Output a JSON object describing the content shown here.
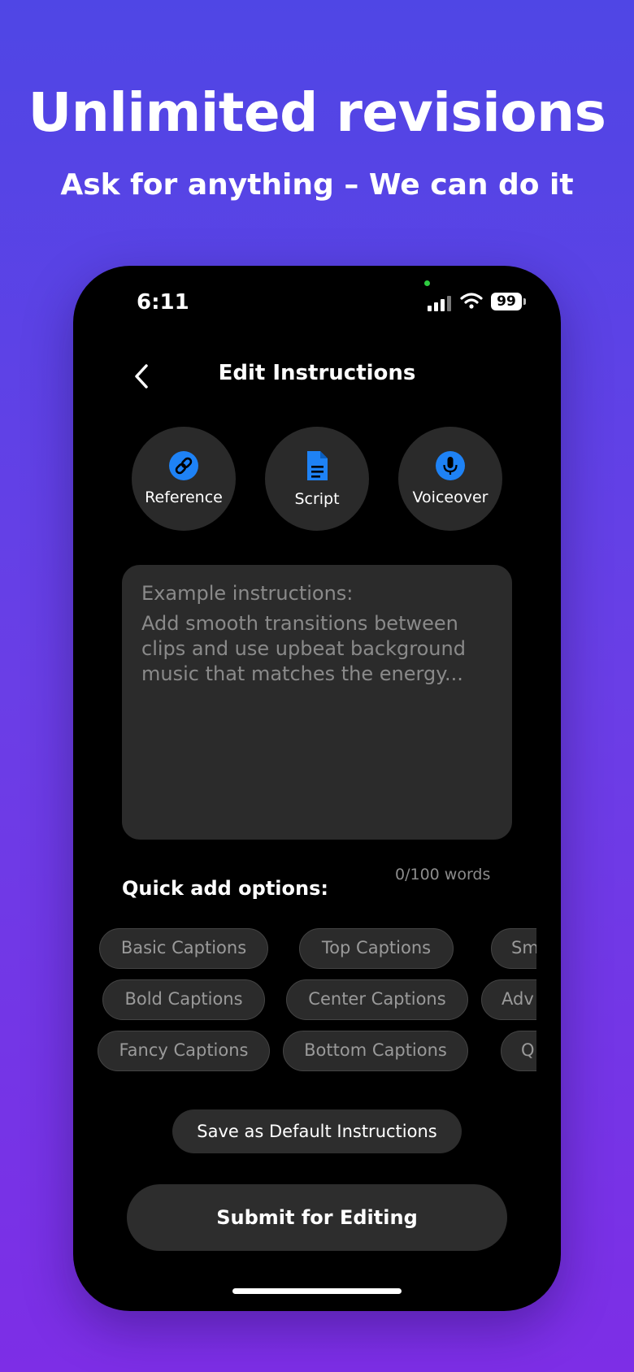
{
  "hero": {
    "title": "Unlimited revisions",
    "subtitle": "Ask for anything – We can do it"
  },
  "status_bar": {
    "time": "6:11",
    "battery": "99"
  },
  "nav": {
    "title": "Edit Instructions",
    "back_icon": "chevron-left-icon"
  },
  "actions": [
    {
      "label": "Reference",
      "icon": "link-icon"
    },
    {
      "label": "Script",
      "icon": "document-icon"
    },
    {
      "label": "Voiceover",
      "icon": "microphone-icon"
    }
  ],
  "instructions": {
    "placeholder_head": "Example instructions:",
    "placeholder_body": "Add smooth transitions between clips and use upbeat background music that matches the energy...",
    "word_count": "0/100 words"
  },
  "quick_add": {
    "label": "Quick add options:",
    "rows": [
      [
        "Basic Captions",
        "Top Captions",
        "Sm"
      ],
      [
        "Bold Captions",
        "Center Captions",
        "Adv"
      ],
      [
        "Fancy Captions",
        "Bottom Captions",
        "Q"
      ]
    ]
  },
  "buttons": {
    "save_default": "Save as Default Instructions",
    "submit": "Submit for Editing"
  },
  "colors": {
    "accent": "#1e82f5",
    "background_top": "#4f46e5",
    "background_bottom": "#7d2ee6"
  }
}
